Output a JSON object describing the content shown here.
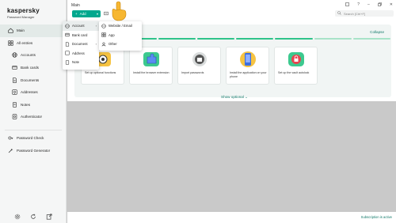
{
  "app": {
    "brand": "kaspersky",
    "product": "Password Manager"
  },
  "sidebar": {
    "items": [
      {
        "label": "Main",
        "icon": "home-icon"
      },
      {
        "label": "All entries",
        "icon": "grid-icon"
      },
      {
        "label": "Accounts",
        "icon": "globe-icon"
      },
      {
        "label": "Bank cards",
        "icon": "card-icon"
      },
      {
        "label": "Documents",
        "icon": "document-icon"
      },
      {
        "label": "Addresses",
        "icon": "address-icon"
      },
      {
        "label": "Notes",
        "icon": "note-icon"
      },
      {
        "label": "Authenticator",
        "icon": "authenticator-icon"
      },
      {
        "label": "Password Check",
        "icon": "password-check-icon"
      },
      {
        "label": "Password Generator",
        "icon": "generator-icon"
      }
    ],
    "bottom_icons": [
      "settings-icon",
      "sync-icon",
      "export-icon"
    ]
  },
  "header": {
    "title": "Main",
    "add_label": "Add",
    "search_placeholder": "Search [Ctrl+F]",
    "window_controls": [
      "save-icon",
      "help-icon",
      "minimize-icon",
      "restore-icon",
      "close-icon"
    ]
  },
  "add_menu": {
    "items": [
      {
        "label": "Account",
        "icon": "globe-icon",
        "has_submenu": true
      },
      {
        "label": "Bank card",
        "icon": "card-icon",
        "has_submenu": false
      },
      {
        "label": "Document",
        "icon": "document-icon",
        "has_submenu": true
      },
      {
        "label": "Address",
        "icon": "address-icon",
        "has_submenu": false
      },
      {
        "label": "Note",
        "icon": "note-icon",
        "has_submenu": false
      }
    ]
  },
  "account_submenu": {
    "items": [
      {
        "label": "Website / Email",
        "icon": "globe-icon"
      },
      {
        "label": "App",
        "icon": "app-icon"
      },
      {
        "label": "Other",
        "icon": "user-icon"
      }
    ]
  },
  "onboarding": {
    "collapse_label": "Collapse",
    "progress_colors": [
      "#2fc38a",
      "#2fc38a",
      "#2fc38a",
      "#2fc38a",
      "#2fc38a",
      "#2fc38a",
      "#a8e3c8",
      "#a8e3c8"
    ],
    "cards": [
      {
        "title": "Set up optional functions",
        "art": "settings-art"
      },
      {
        "title": "Install the browser extension",
        "art": "extension-art"
      },
      {
        "title": "Import passwords",
        "art": "import-art"
      },
      {
        "title": "Install the application on your phone",
        "art": "phone-art"
      },
      {
        "title": "Set up the vault autolock",
        "art": "lock-art"
      }
    ],
    "show_optional_label": "Show optional"
  },
  "footer": {
    "subscription_label": "Subscription is active"
  },
  "colors": {
    "accent": "#00a88e",
    "link": "#127a6a"
  }
}
